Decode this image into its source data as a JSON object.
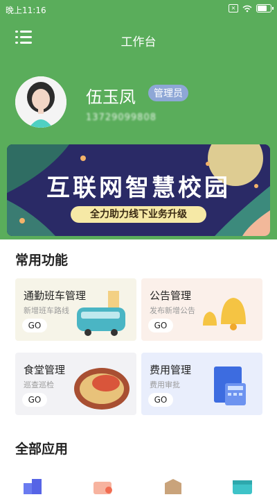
{
  "status_bar": {
    "time": "晚上11:16",
    "battery_level": 0.7
  },
  "header": {
    "title": "工作台"
  },
  "user": {
    "name": "伍玉凤",
    "role": "管理员",
    "phone": "13729099808"
  },
  "banner": {
    "title": "互联网智慧校园",
    "subtitle": "全力助力线下业务升级"
  },
  "sections": {
    "common": "常用功能",
    "all_apps": "全部应用"
  },
  "cards": [
    {
      "title": "通勤班车管理",
      "subtitle": "新增班车路线",
      "go": "GO"
    },
    {
      "title": "公告管理",
      "subtitle": "发布新增公告",
      "go": "GO"
    },
    {
      "title": "食堂管理",
      "subtitle": "巡查巡检",
      "go": "GO"
    },
    {
      "title": "费用管理",
      "subtitle": "费用审批",
      "go": "GO"
    }
  ],
  "colors": {
    "primary": "#5aad5b",
    "badge": "#8ea7d6"
  }
}
